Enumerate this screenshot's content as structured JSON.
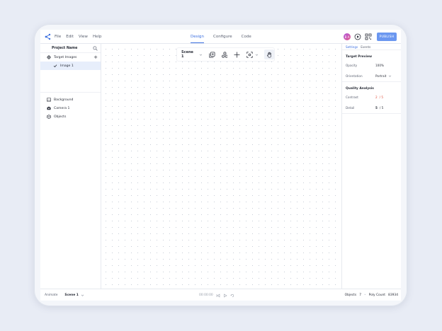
{
  "menu": {
    "file": "File",
    "edit": "Edit",
    "view": "View",
    "help": "Help"
  },
  "tabs": {
    "design": "Design",
    "configure": "Configure",
    "code": "Code"
  },
  "header": {
    "avatar_initials": "B A",
    "publish_label": "PUBLISH"
  },
  "left_panel": {
    "project_name": "Project Name",
    "target_images_label": "Target Images",
    "image_item_label": "Image 1",
    "background_label": "Background",
    "camera_label": "Camera 1",
    "objects_label": "Objects"
  },
  "toolbar": {
    "scene_label": "Scene 1"
  },
  "right_panel": {
    "tab_settings": "Settings",
    "tab_events": "Events",
    "target_preview_title": "Target Preview",
    "opacity_label": "Opacity",
    "opacity_value": "100%",
    "orientation_label": "Orientation",
    "orientation_value": "Portrait",
    "quality_title": "Quality Analysis",
    "contrast_label": "Contrast",
    "contrast_score": "2",
    "contrast_max": "/ 5",
    "detail_label": "Detail",
    "detail_score": "5",
    "detail_max": "/ 5"
  },
  "bottom_bar": {
    "animate_label": "Animate",
    "scene_label": "Scene 1",
    "timecode": "00:00:00",
    "objects_label": "Objects",
    "objects_count": "7",
    "poly_label": "Poly Count",
    "poly_count": "83934"
  },
  "colors": {
    "accent": "#3b6fe0",
    "publish": "#6b97f0",
    "contrast_warning": "#e0503c"
  }
}
